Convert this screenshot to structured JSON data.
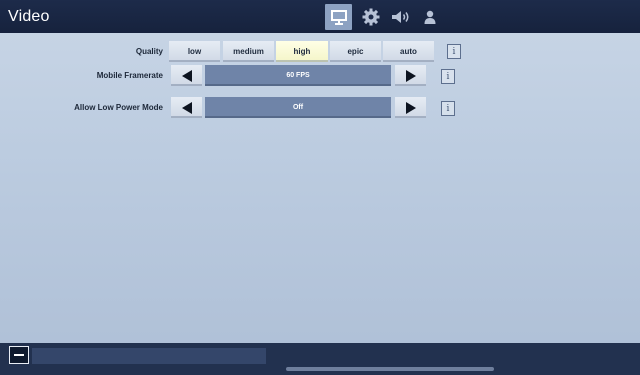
{
  "header": {
    "title": "Video",
    "tabs": [
      {
        "name": "video",
        "icon": "monitor-icon",
        "active": true
      },
      {
        "name": "game",
        "icon": "gear-icon",
        "active": false
      },
      {
        "name": "audio",
        "icon": "speaker-icon",
        "active": false
      },
      {
        "name": "account",
        "icon": "person-icon",
        "active": false
      }
    ]
  },
  "settings": {
    "quality": {
      "label": "Quality",
      "options": [
        "low",
        "medium",
        "high",
        "epic",
        "auto"
      ],
      "selected": "high"
    },
    "framerate": {
      "label": "Mobile Framerate",
      "value": "60 FPS"
    },
    "low_power": {
      "label": "Allow Low Power Mode",
      "value": "Off"
    },
    "info_glyph": "i"
  },
  "colors": {
    "accent_selected": "#f4f5c8",
    "value_box": "#6f84a8",
    "header_bg": "#1d2b4a"
  }
}
